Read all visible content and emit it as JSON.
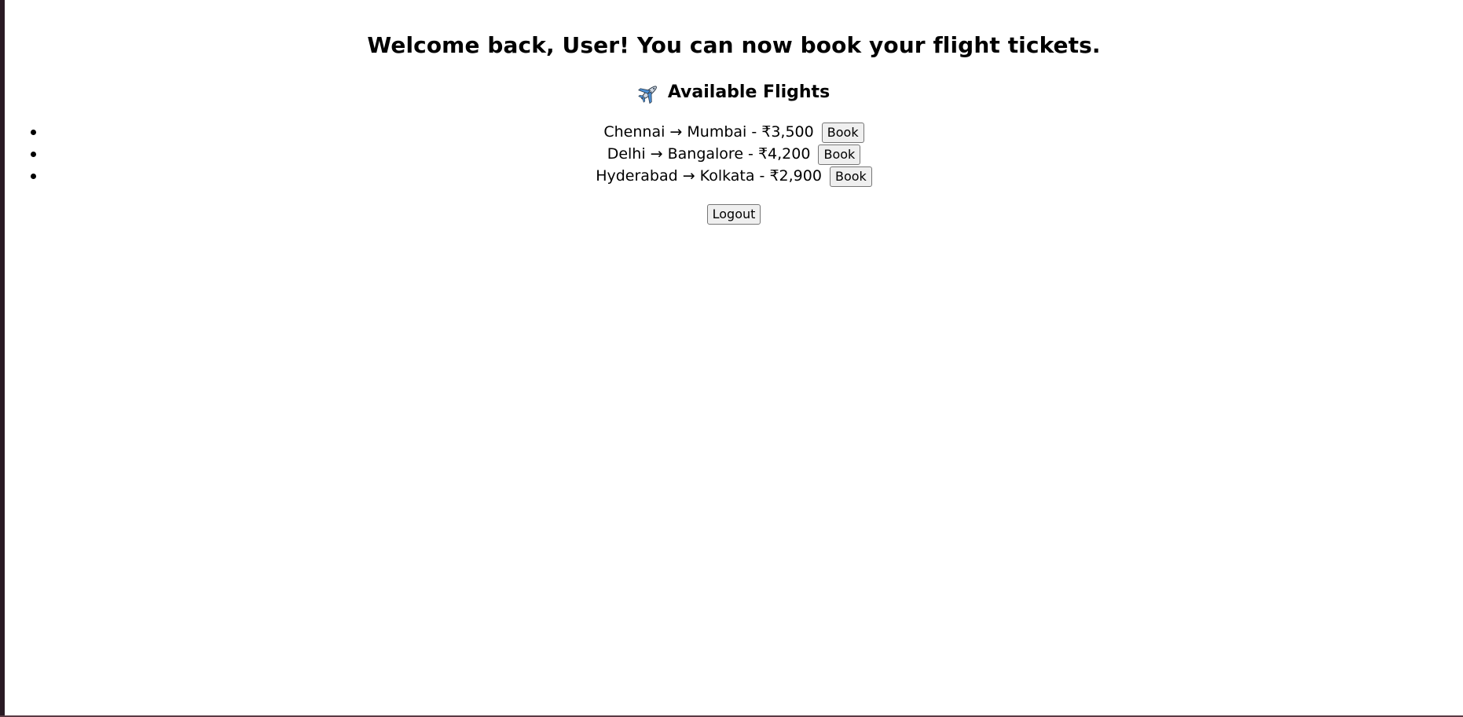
{
  "header": {
    "title": "Welcome back, User! You can now book your flight tickets."
  },
  "flights_section": {
    "icon": "airplane-icon",
    "title": "Available Flights",
    "items": [
      {
        "route": "Chennai → Mumbai - ₹3,500",
        "button_label": "Book"
      },
      {
        "route": "Delhi → Bangalore - ₹4,200",
        "button_label": "Book"
      },
      {
        "route": "Hyderabad → Kolkata - ₹2,900",
        "button_label": "Book"
      }
    ]
  },
  "actions": {
    "logout_label": "Logout"
  },
  "colors": {
    "page_background": "#ffffff",
    "window_frame": "#2a1a24",
    "button_background": "#efefef",
    "button_border": "#767676",
    "plane_blue": "#4a8fd6"
  }
}
